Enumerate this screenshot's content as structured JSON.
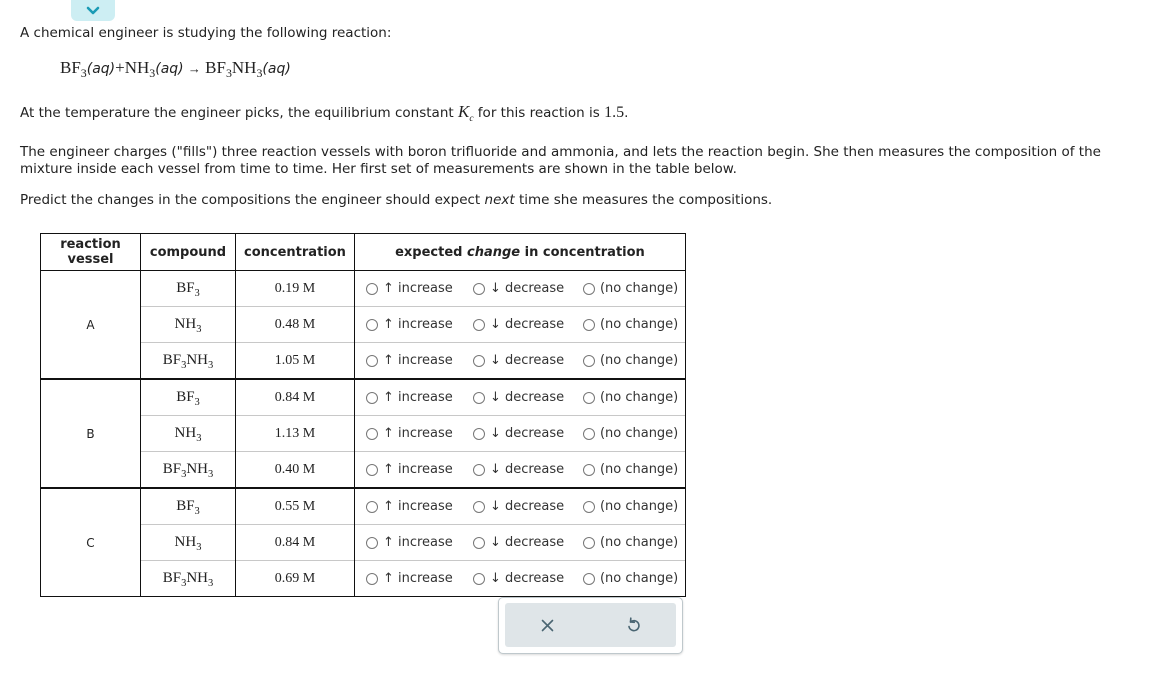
{
  "intro": "A chemical engineer is studying the following reaction:",
  "equation": {
    "r1": "BF",
    "r1_sub": "3",
    "r1_state": "(aq)",
    "plus": "+",
    "r2": "NH",
    "r2_sub": "3",
    "r2_state": "(aq)",
    "arrow": "→",
    "p1a": "BF",
    "p1a_sub": "3",
    "p1b": "NH",
    "p1b_sub": "3",
    "p1_state": "(aq)"
  },
  "kc_text": {
    "before": "At the temperature the engineer picks, the equilibrium constant ",
    "k": "K",
    "k_sub": "c",
    "middle": " for this reaction is ",
    "value": "1.5",
    "end": "."
  },
  "para2_line1": "The engineer charges (\"fills\") three reaction vessels with boron trifluoride and ammonia, and lets the reaction begin. She then measures the composition of the",
  "para2_line2": "mixture inside each vessel from time to time. Her first set of measurements are shown in the table below.",
  "predict": {
    "before": "Predict the changes in the compositions the engineer should expect ",
    "em": "next",
    "after": " time she measures the compositions."
  },
  "table": {
    "headers": {
      "vessel": "reaction vessel",
      "compound": "compound",
      "concentration": "concentration",
      "change_before": "expected ",
      "change_em": "change",
      "change_after": " in concentration"
    },
    "options": [
      "↑ increase",
      "↓ decrease",
      "(no change)"
    ],
    "vessels": [
      {
        "name": "A",
        "rows": [
          {
            "compound": "BF₃",
            "concentration": "0.19 M"
          },
          {
            "compound": "NH₃",
            "concentration": "0.48 M"
          },
          {
            "compound": "BF₃NH₃",
            "concentration": "1.05 M"
          }
        ]
      },
      {
        "name": "B",
        "rows": [
          {
            "compound": "BF₃",
            "concentration": "0.84 M"
          },
          {
            "compound": "NH₃",
            "concentration": "1.13 M"
          },
          {
            "compound": "BF₃NH₃",
            "concentration": "0.40 M"
          }
        ]
      },
      {
        "name": "C",
        "rows": [
          {
            "compound": "BF₃",
            "concentration": "0.55 M"
          },
          {
            "compound": "NH₃",
            "concentration": "0.84 M"
          },
          {
            "compound": "BF₃NH₃",
            "concentration": "0.69 M"
          }
        ]
      }
    ]
  },
  "buttons": {
    "clear": "×",
    "reset": "↺"
  },
  "colors": {
    "accent": "#1a9bb5",
    "tab_bg": "#cdeef3",
    "button_bar": "#dfe5e8",
    "icon": "#4a6572"
  }
}
